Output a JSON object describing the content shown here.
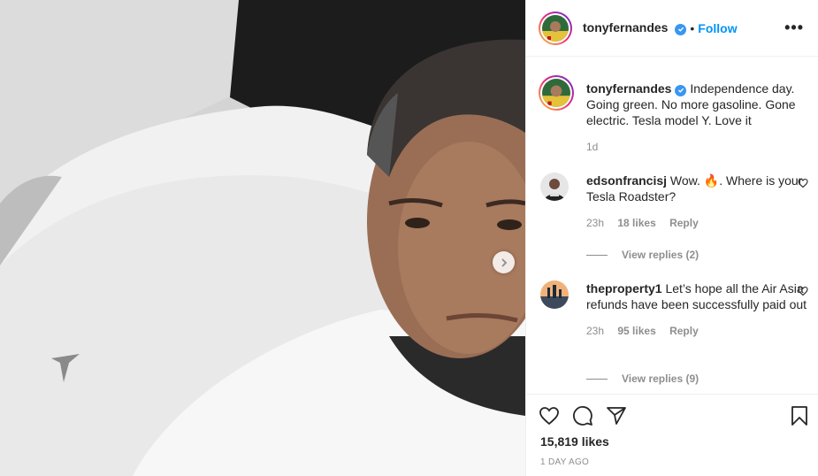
{
  "post": {
    "username": "tonyfernandes",
    "follow_label": "Follow",
    "dot": "•",
    "more_label": "•••"
  },
  "caption": {
    "username": "tonyfernandes",
    "text": "Independence day. Going green. No more gasoline. Gone electric. Tesla model Y. Love it",
    "age": "1d"
  },
  "comments": [
    {
      "username": "edsonfrancisj",
      "text": "Wow. 🔥. Where is your Tesla Roadster?",
      "age": "23h",
      "likes": "18 likes",
      "reply_label": "Reply",
      "view_replies": "View replies (2)"
    },
    {
      "username": "theproperty1",
      "text": "Let’s hope all the Air Asia refunds have been successfully paid out",
      "age": "23h",
      "likes": "95 likes",
      "reply_label": "Reply",
      "view_replies": "View replies (9)"
    }
  ],
  "footer": {
    "likes": "15,819 likes",
    "posted": "1 DAY AGO"
  },
  "icons": {
    "like": "heart-icon",
    "comment": "comment-icon",
    "share": "share-icon",
    "save": "bookmark-icon",
    "next": "chevron-right-icon",
    "verified": "verified-badge-icon"
  },
  "colors": {
    "link_blue": "#0095f6",
    "verified_blue": "#3897f0",
    "muted_text": "#8e8e8e",
    "text": "#262626"
  }
}
